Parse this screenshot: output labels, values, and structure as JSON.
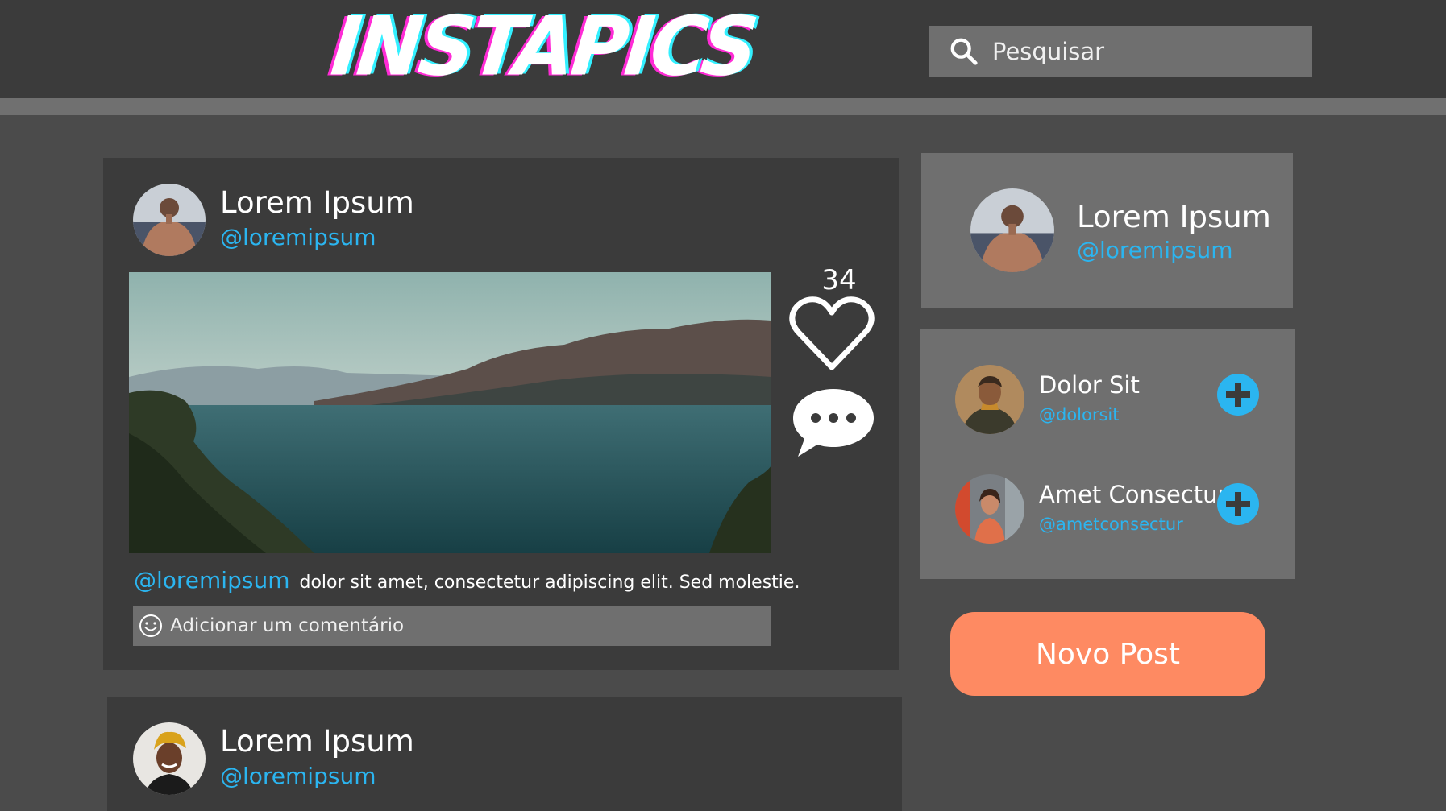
{
  "header": {
    "logo_text": "INSTAPICS",
    "search": {
      "placeholder": "Pesquisar",
      "icon": "search-icon"
    }
  },
  "feed": {
    "posts": [
      {
        "author_name": "Lorem Ipsum",
        "author_handle": "@loremipsum",
        "image": "lake-mountains-landscape",
        "likes": "34",
        "caption_handle": "@loremipsum",
        "caption_text": "dolor sit amet, consectetur adipiscing elit. Sed molestie.",
        "comment_placeholder": "Adicionar um comentário"
      },
      {
        "author_name": "Lorem Ipsum",
        "author_handle": "@loremipsum"
      }
    ]
  },
  "sidebar": {
    "profile": {
      "name": "Lorem Ipsum",
      "handle": "@loremipsum"
    },
    "suggestions": [
      {
        "name": "Dolor Sit",
        "handle": "@dolorsit"
      },
      {
        "name": "Amet Consectur",
        "handle": "@ametconsectur"
      }
    ],
    "new_post_label": "Novo Post"
  },
  "colors": {
    "background": "#4b4b4b",
    "card_dark": "#3b3b3b",
    "card_light": "#6f6f6f",
    "handle_blue": "#2bb5f0",
    "accent_orange": "#fe8a62"
  }
}
